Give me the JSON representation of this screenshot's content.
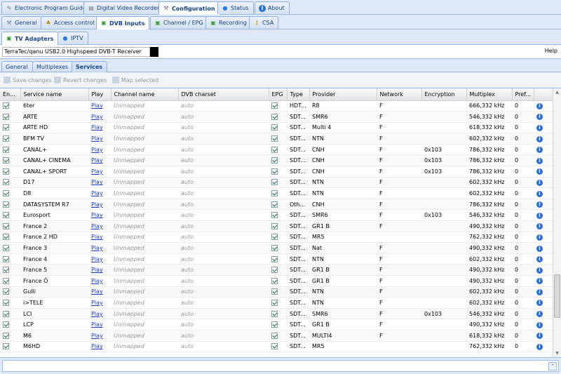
{
  "main_tabs": [
    {
      "label": "Electronic Program Guide",
      "icon": "doc-icon"
    },
    {
      "label": "Digital Video Recorder",
      "icon": "doc-icon"
    },
    {
      "label": "Configuration",
      "icon": "wrench-icon"
    },
    {
      "label": "Status",
      "icon": "globe-icon"
    },
    {
      "label": "About",
      "icon": "info-icon"
    }
  ],
  "config_tabs": [
    {
      "label": "General"
    },
    {
      "label": "Access control"
    },
    {
      "label": "DVB Inputs"
    },
    {
      "label": "Channel / EPG"
    },
    {
      "label": "Recording"
    },
    {
      "label": "CSA"
    }
  ],
  "dvb_tabs": [
    {
      "label": "TV Adapters"
    },
    {
      "label": "IPTV"
    }
  ],
  "adapter": {
    "selected": "TerraTec/qanu USB2.0 Highspeed DVB-T Receiver",
    "help": "Help"
  },
  "sub_tabs": [
    {
      "label": "General"
    },
    {
      "label": "Multiplexes"
    },
    {
      "label": "Services"
    }
  ],
  "toolbar": {
    "save": "Save changes",
    "revert": "Revert changes",
    "map": "Map selected"
  },
  "columns": [
    "En...",
    "Service name",
    "Play",
    "Channel name",
    "DVB charset",
    "EPG",
    "Type",
    "Provider",
    "Network",
    "Encryption",
    "Multiplex",
    "Pref...",
    ""
  ],
  "rows": [
    {
      "name": "6ter",
      "play": "Play",
      "channel": "Unmapped",
      "charset": "auto",
      "type": "HDT...",
      "provider": "R8",
      "network": "F",
      "enc": "",
      "mux": "666,332 kHz",
      "pref": "0"
    },
    {
      "name": "ARTE",
      "play": "Play",
      "channel": "Unmapped",
      "charset": "auto",
      "type": "SDT...",
      "provider": "SMR6",
      "network": "F",
      "enc": "",
      "mux": "546,332 kHz",
      "pref": "0"
    },
    {
      "name": "ARTE HD",
      "play": "Play",
      "channel": "Unmapped",
      "charset": "auto",
      "type": "SDT...",
      "provider": "Multi 4",
      "network": "F",
      "enc": "",
      "mux": "618,332 kHz",
      "pref": "0"
    },
    {
      "name": "BFM TV",
      "play": "Play",
      "channel": "Unmapped",
      "charset": "auto",
      "type": "SDT...",
      "provider": "NTN",
      "network": "F",
      "enc": "",
      "mux": "602,332 kHz",
      "pref": "0"
    },
    {
      "name": "CANAL+",
      "play": "Play",
      "channel": "Unmapped",
      "charset": "auto",
      "type": "SDT...",
      "provider": "CNH",
      "network": "F",
      "enc": "0x103",
      "mux": "786,332 kHz",
      "pref": "0"
    },
    {
      "name": "CANAL+ CINEMA",
      "play": "Play",
      "channel": "Unmapped",
      "charset": "auto",
      "type": "SDT...",
      "provider": "CNH",
      "network": "F",
      "enc": "0x103",
      "mux": "786,332 kHz",
      "pref": "0"
    },
    {
      "name": "CANAL+ SPORT",
      "play": "Play",
      "channel": "Unmapped",
      "charset": "auto",
      "type": "SDT...",
      "provider": "CNH",
      "network": "F",
      "enc": "0x103",
      "mux": "786,332 kHz",
      "pref": "0"
    },
    {
      "name": "D17",
      "play": "Play",
      "channel": "Unmapped",
      "charset": "auto",
      "type": "SDT...",
      "provider": "NTN",
      "network": "F",
      "enc": "",
      "mux": "602,332 kHz",
      "pref": "0"
    },
    {
      "name": "D8",
      "play": "Play",
      "channel": "Unmapped",
      "charset": "auto",
      "type": "SDT...",
      "provider": "NTN",
      "network": "F",
      "enc": "",
      "mux": "602,332 kHz",
      "pref": "0"
    },
    {
      "name": "DATASYSTEM R7",
      "play": "Play",
      "channel": "Unmapped",
      "charset": "auto",
      "type": "Oth...",
      "provider": "CNH",
      "network": "F",
      "enc": "",
      "mux": "786,332 kHz",
      "pref": "0"
    },
    {
      "name": "Eurosport",
      "play": "Play",
      "channel": "Unmapped",
      "charset": "auto",
      "type": "SDT...",
      "provider": "SMR6",
      "network": "F",
      "enc": "0x103",
      "mux": "546,332 kHz",
      "pref": "0"
    },
    {
      "name": "France 2",
      "play": "Play",
      "channel": "Unmapped",
      "charset": "auto",
      "type": "SDT...",
      "provider": "GR1 B",
      "network": "F",
      "enc": "",
      "mux": "490,332 kHz",
      "pref": "0"
    },
    {
      "name": "France 2 HD",
      "play": "Play",
      "channel": "Unmapped",
      "charset": "auto",
      "type": "SDT...",
      "provider": "MR5",
      "network": "",
      "enc": "",
      "mux": "762,332 kHz",
      "pref": "0"
    },
    {
      "name": "France 3",
      "play": "Play",
      "channel": "Unmapped",
      "charset": "auto",
      "type": "SDT...",
      "provider": "Nat",
      "network": "F",
      "enc": "",
      "mux": "490,332 kHz",
      "pref": "0"
    },
    {
      "name": "France 4",
      "play": "Play",
      "channel": "Unmapped",
      "charset": "auto",
      "type": "SDT...",
      "provider": "NTN",
      "network": "F",
      "enc": "",
      "mux": "602,332 kHz",
      "pref": "0"
    },
    {
      "name": "France 5",
      "play": "Play",
      "channel": "Unmapped",
      "charset": "auto",
      "type": "SDT...",
      "provider": "GR1 B",
      "network": "F",
      "enc": "",
      "mux": "490,332 kHz",
      "pref": "0"
    },
    {
      "name": "France Ô",
      "play": "Play",
      "channel": "Unmapped",
      "charset": "auto",
      "type": "SDT...",
      "provider": "GR1 B",
      "network": "F",
      "enc": "",
      "mux": "490,332 kHz",
      "pref": "0"
    },
    {
      "name": "Gulli",
      "play": "Play",
      "channel": "Unmapped",
      "charset": "auto",
      "type": "SDT...",
      "provider": "NTN",
      "network": "F",
      "enc": "",
      "mux": "602,332 kHz",
      "pref": "0"
    },
    {
      "name": "i>TELE",
      "play": "Play",
      "channel": "Unmapped",
      "charset": "auto",
      "type": "SDT...",
      "provider": "NTN",
      "network": "F",
      "enc": "",
      "mux": "602,332 kHz",
      "pref": "0"
    },
    {
      "name": "LCI",
      "play": "Play",
      "channel": "Unmapped",
      "charset": "auto",
      "type": "SDT...",
      "provider": "SMR6",
      "network": "F",
      "enc": "0x103",
      "mux": "546,332 kHz",
      "pref": "0"
    },
    {
      "name": "LCP",
      "play": "Play",
      "channel": "Unmapped",
      "charset": "auto",
      "type": "SDT...",
      "provider": "GR1 B",
      "network": "F",
      "enc": "",
      "mux": "490,332 kHz",
      "pref": "0"
    },
    {
      "name": "M6",
      "play": "Play",
      "channel": "Unmapped",
      "charset": "auto",
      "type": "SDT...",
      "provider": "MULTI4",
      "network": "F",
      "enc": "",
      "mux": "618,332 kHz",
      "pref": "0"
    },
    {
      "name": "M6HD",
      "play": "Play",
      "channel": "Unmapped",
      "charset": "auto",
      "type": "SDT...",
      "provider": "MR5",
      "network": "",
      "enc": "",
      "mux": "762,332 kHz",
      "pref": "0"
    }
  ]
}
